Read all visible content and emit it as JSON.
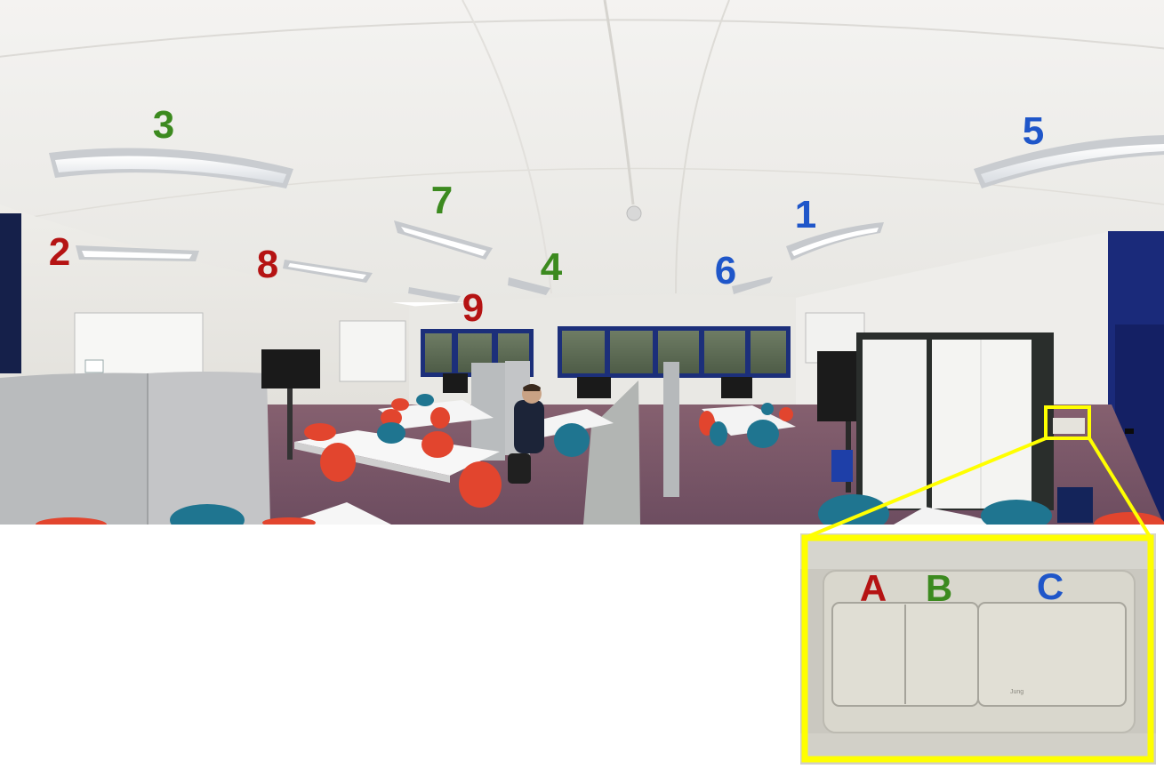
{
  "colors": {
    "label_red": "#b51313",
    "label_green": "#3c8a1f",
    "label_blue": "#1f56c9",
    "highlight_yellow": "#ffff00",
    "wall": "#eceae6",
    "carpet": "#7a5670",
    "window_frame": "#1c2f7a"
  },
  "light_labels": [
    {
      "id": "1",
      "text": "1",
      "color": "blue"
    },
    {
      "id": "2",
      "text": "2",
      "color": "red"
    },
    {
      "id": "3",
      "text": "3",
      "color": "green"
    },
    {
      "id": "4",
      "text": "4",
      "color": "green"
    },
    {
      "id": "5",
      "text": "5",
      "color": "blue"
    },
    {
      "id": "6",
      "text": "6",
      "color": "blue"
    },
    {
      "id": "7",
      "text": "7",
      "color": "green"
    },
    {
      "id": "8",
      "text": "8",
      "color": "red"
    },
    {
      "id": "9",
      "text": "9",
      "color": "red"
    }
  ],
  "switch_labels": [
    {
      "id": "A",
      "text": "A",
      "color": "red"
    },
    {
      "id": "B",
      "text": "B",
      "color": "green"
    },
    {
      "id": "C",
      "text": "C",
      "color": "blue"
    }
  ],
  "switch_brand_mark": "Jung"
}
